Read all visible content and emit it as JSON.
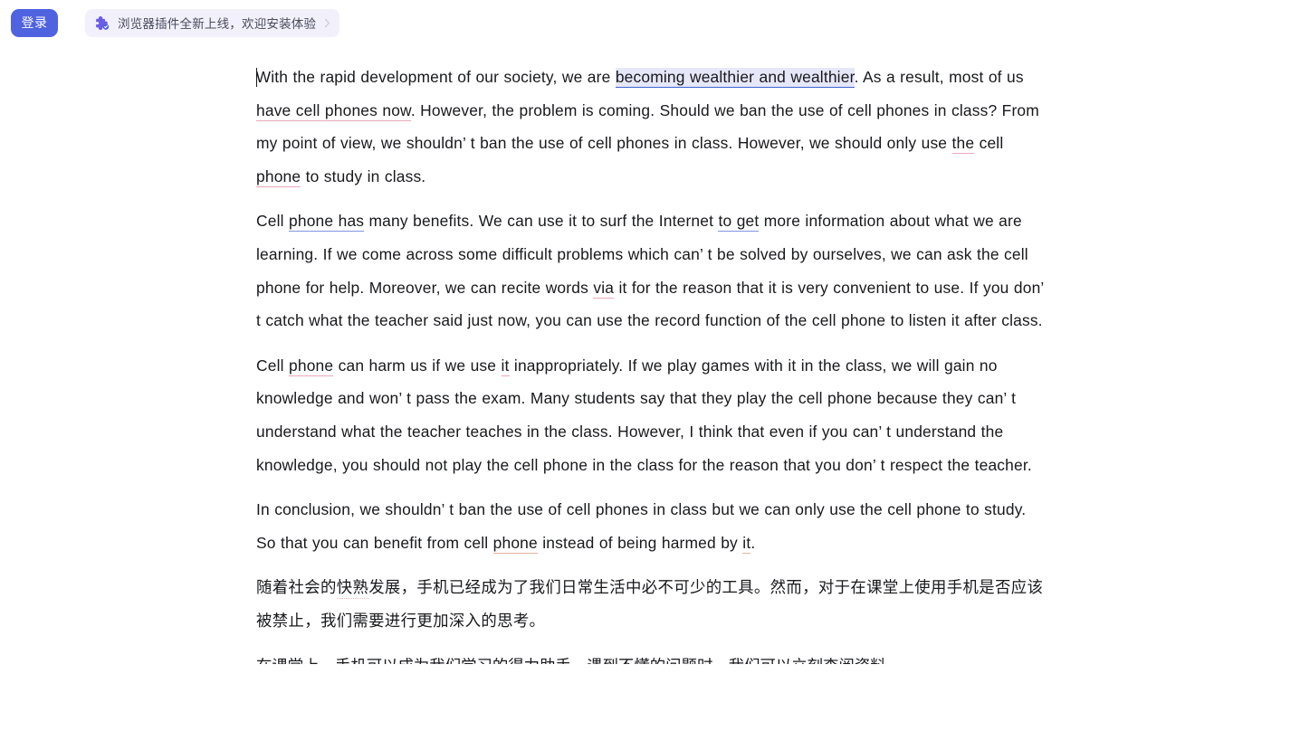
{
  "topbar": {
    "login_label": "登录",
    "promo_text": "浏览器插件全新上线，欢迎安装体验",
    "promo_icon": "puzzle-piece-icon",
    "promo_chevron": "chevron-right-icon"
  },
  "colors": {
    "accent": "#4f63e0",
    "promo_bg": "#f1f0fb",
    "highlight_bg": "#e6e7f8",
    "blue_underline": "#3f63cf",
    "blue_underline_soft": "#7e93e0",
    "pink_underline": "#eaa9b9",
    "orange_underline": "#e6b49b",
    "text": "#18191c"
  },
  "document": {
    "paragraphs": [
      {
        "id": "p1",
        "segments": [
          {
            "text": "With the rapid development of our society, we are ",
            "mark": "none"
          },
          {
            "text": "becoming wealthier and wealthier",
            "mark": "blue-highlight"
          },
          {
            "text": ". As a result, most of us ",
            "mark": "none"
          },
          {
            "text": "have cell phones now",
            "mark": "pink"
          },
          {
            "text": ". However, the problem is coming. Should we ban the use of cell phones in class? From my point of view, we shouldn’ t ban the use of cell phones in class. However, we should only use ",
            "mark": "none"
          },
          {
            "text": "the",
            "mark": "pink"
          },
          {
            "text": " cell ",
            "mark": "none"
          },
          {
            "text": "phone",
            "mark": "pink"
          },
          {
            "text": " to study in class.",
            "mark": "none"
          }
        ]
      },
      {
        "id": "p2",
        "segments": [
          {
            "text": "Cell ",
            "mark": "none"
          },
          {
            "text": "phone has",
            "mark": "blue-underline"
          },
          {
            "text": " many benefits. We can use it to surf the Internet ",
            "mark": "none"
          },
          {
            "text": "to get",
            "mark": "blue-underline"
          },
          {
            "text": " more information about what we are learning. If we come across some difficult problems which can’ t be solved by ourselves, we can ask the cell phone for help. Moreover, we can recite words ",
            "mark": "none"
          },
          {
            "text": "via",
            "mark": "pink"
          },
          {
            "text": " it for the reason that it is very convenient to use. If you don’ t catch what the teacher said just now, you can use the record function of the cell phone to listen it after class.",
            "mark": "none"
          }
        ]
      },
      {
        "id": "p3",
        "segments": [
          {
            "text": "Cell ",
            "mark": "none"
          },
          {
            "text": "phone",
            "mark": "pink"
          },
          {
            "text": " can harm us if we use ",
            "mark": "none"
          },
          {
            "text": "it",
            "mark": "pink"
          },
          {
            "text": " inappropriately. If we play games with it in the class, we will gain no knowledge and won’ t pass the exam. Many students say that they play the cell phone because they can’ t understand what the teacher teaches in the class. However, I think that even if you can’ t understand the knowledge, you should not play the cell phone in the class for the reason that you don’ t respect the teacher.",
            "mark": "none"
          }
        ]
      },
      {
        "id": "p4",
        "segments": [
          {
            "text": "In conclusion, we shouldn’ t ban the use of cell phones in class but we can only use the cell phone to study. So that you can benefit from cell ",
            "mark": "none"
          },
          {
            "text": "phone",
            "mark": "orange"
          },
          {
            "text": " instead of being harmed by ",
            "mark": "none"
          },
          {
            "text": "it",
            "mark": "orange"
          },
          {
            "text": ".",
            "mark": "none"
          }
        ]
      },
      {
        "id": "p5",
        "lang": "cn",
        "segments": [
          {
            "text": "随着社会的",
            "mark": "none"
          },
          {
            "text": "快熟",
            "mark": "cn-dotted"
          },
          {
            "text": "发展，手机已经成为了我们日常生活中必不可少的工具。然而，对于在课堂上使用手机是否应该被禁止，我们需要进行更加深入的思考。",
            "mark": "none"
          }
        ]
      }
    ],
    "clipped_line_text": "在课堂上，手机可以成为我们学习的得力助手。遇到不懂的问题时，我们可以立刻查阅资料。"
  }
}
